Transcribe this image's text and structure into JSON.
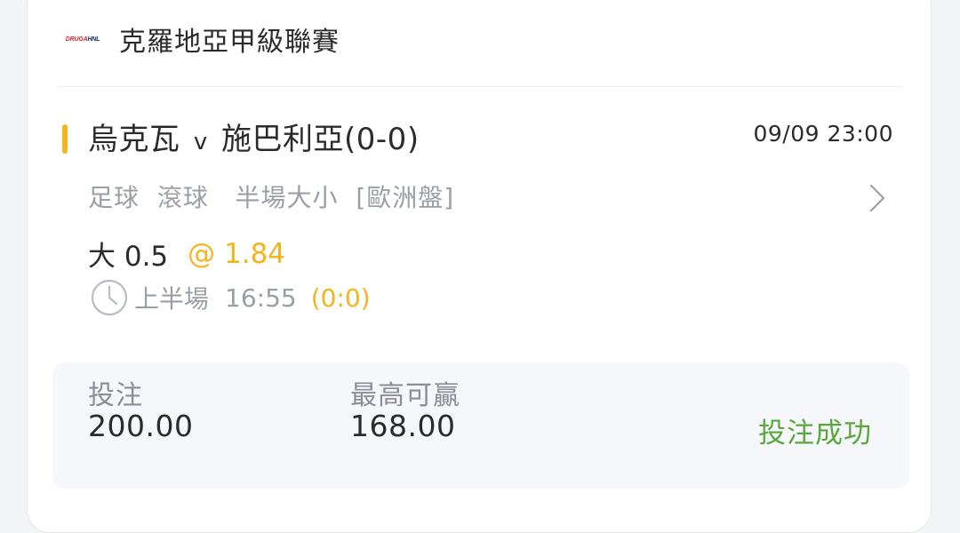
{
  "league": {
    "logo_text_left": "DRUGA",
    "logo_text_right": "HNL",
    "name": "克羅地亞甲級聯賽"
  },
  "match": {
    "home": "烏克瓦",
    "vs": "v",
    "away": "施巴利亞",
    "score": "(0-0)",
    "datetime": "09/09 23:00"
  },
  "market": {
    "sport": "足球",
    "mode": "滾球",
    "type": "半場大小",
    "odds_format": "[歐洲盤]"
  },
  "selection": {
    "pick": "大 0.5",
    "odds": "@ 1.84"
  },
  "status": {
    "clock_icon": "clock-icon",
    "period": "上半場",
    "time": "16:55",
    "score": "(0:0)"
  },
  "summary": {
    "stake_label": "投注",
    "stake_value": "200.00",
    "max_win_label": "最高可贏",
    "max_win_value": "168.00",
    "result": "投注成功"
  },
  "colors": {
    "accent": "#f5b41e",
    "success": "#5aa83c",
    "muted_text": "#9a9ea6",
    "primary_text": "#2b2b2b"
  }
}
